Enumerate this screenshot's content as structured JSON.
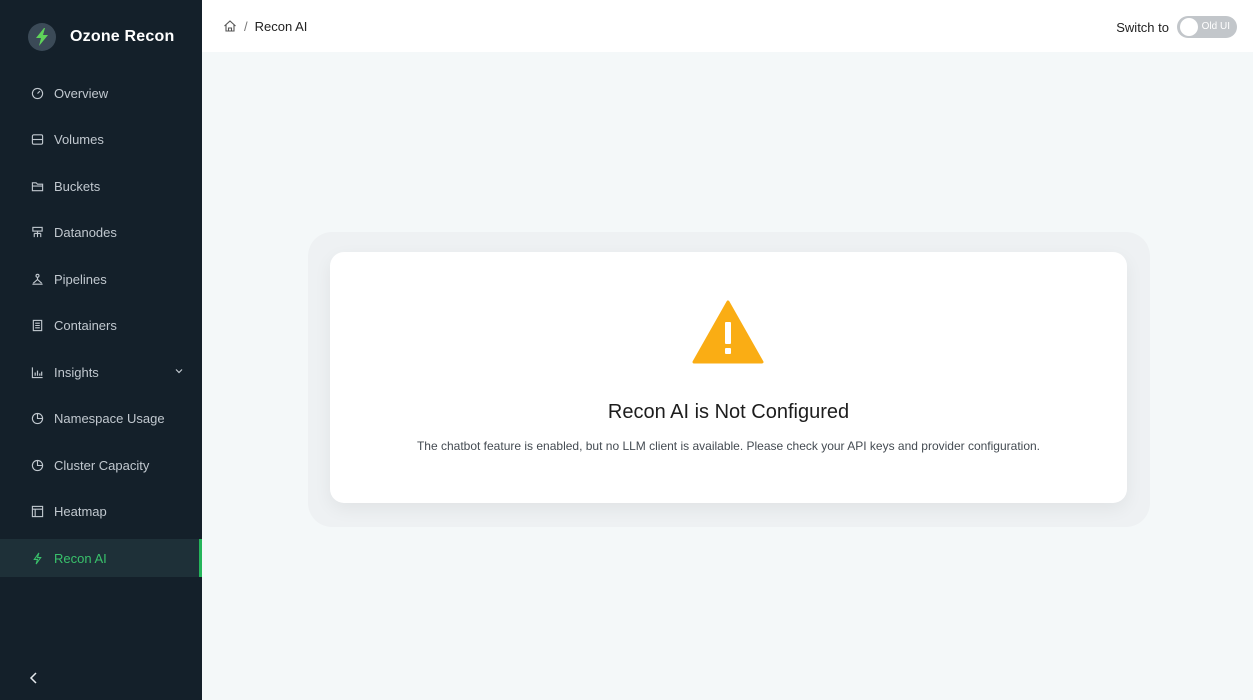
{
  "app": {
    "title": "Ozone Recon"
  },
  "sidebar": {
    "items": [
      {
        "label": "Overview",
        "icon": "dashboard-icon"
      },
      {
        "label": "Volumes",
        "icon": "inbox-icon"
      },
      {
        "label": "Buckets",
        "icon": "folder-open-icon"
      },
      {
        "label": "Datanodes",
        "icon": "cluster-icon"
      },
      {
        "label": "Pipelines",
        "icon": "deployment-icon"
      },
      {
        "label": "Containers",
        "icon": "container-icon"
      },
      {
        "label": "Insights",
        "icon": "bar-chart-icon"
      },
      {
        "label": "Namespace Usage",
        "icon": "pie-chart-icon"
      },
      {
        "label": "Cluster Capacity",
        "icon": "pie-chart-icon"
      },
      {
        "label": "Heatmap",
        "icon": "layout-icon"
      },
      {
        "label": "Recon AI",
        "icon": "thunderbolt-icon"
      }
    ],
    "active": "Recon AI",
    "accent_color": "#25b55b"
  },
  "header": {
    "breadcrumb": {
      "current": "Recon AI"
    },
    "switch_label": "Switch to",
    "toggle_label": "Old UI"
  },
  "main": {
    "title": "Recon AI is Not Configured",
    "description": "The chatbot feature is enabled, but no LLM client is available. Please check your API keys and provider configuration.",
    "warning_color": "#faad14"
  }
}
